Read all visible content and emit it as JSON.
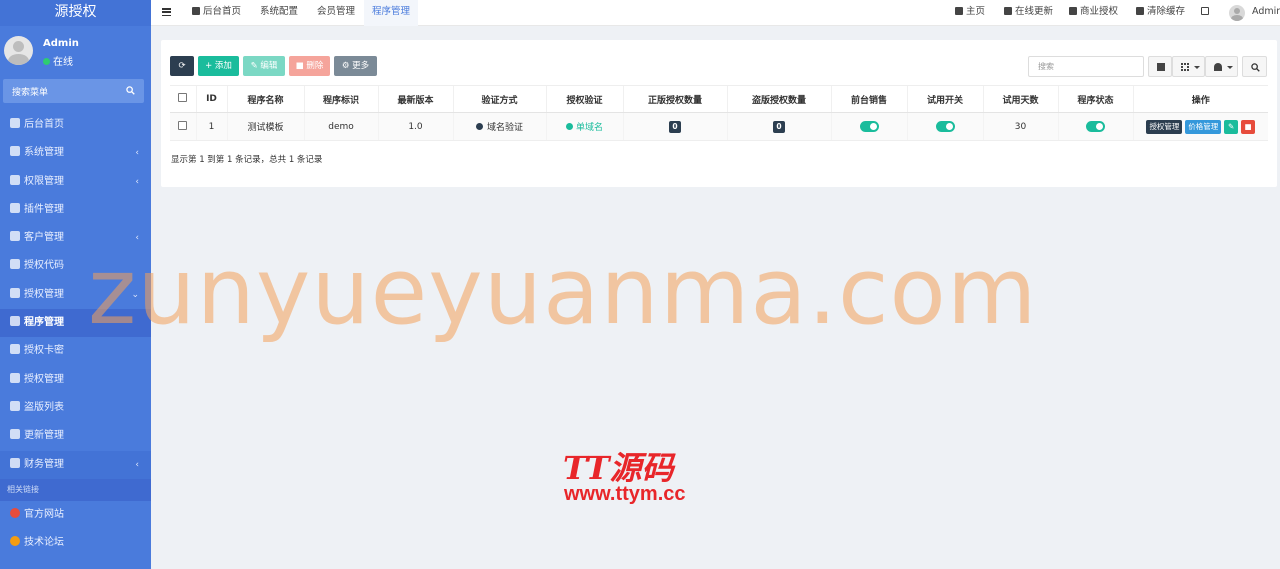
{
  "sidebar": {
    "brand": "源授权",
    "user": {
      "name": "Admin",
      "status": "在线"
    },
    "search_label": "搜索菜单",
    "items": [
      {
        "label": "后台首页",
        "icon": "dashboard-icon",
        "has_sub": false
      },
      {
        "label": "系统管理",
        "icon": "cogs-icon",
        "has_sub": true
      },
      {
        "label": "权限管理",
        "icon": "group-icon",
        "has_sub": true
      },
      {
        "label": "插件管理",
        "icon": "rocket-icon",
        "has_sub": false
      },
      {
        "label": "客户管理",
        "icon": "list-icon",
        "has_sub": true
      },
      {
        "label": "授权代码",
        "icon": "code-icon",
        "has_sub": false
      },
      {
        "label": "授权管理",
        "icon": "shield-icon",
        "has_sub": true,
        "open": true
      },
      {
        "label": "程序管理",
        "icon": "cloud-icon",
        "active": true
      },
      {
        "label": "授权卡密",
        "icon": "card-icon"
      },
      {
        "label": "授权管理",
        "icon": "copy-icon"
      },
      {
        "label": "盗版列表",
        "icon": "user-secret-icon"
      },
      {
        "label": "更新管理",
        "icon": "vimeo-icon"
      },
      {
        "label": "财务管理",
        "icon": "send-icon",
        "has_sub": true
      }
    ],
    "section_label": "相关链接",
    "links": [
      {
        "label": "官方网站",
        "color": "#e74c3c"
      },
      {
        "label": "技术论坛",
        "color": "#f39c12"
      }
    ]
  },
  "topnav": {
    "tabs": [
      "后台首页",
      "系统配置",
      "会员管理",
      "程序管理"
    ],
    "active_tab": "程序管理",
    "right": [
      "主页",
      "在线更新",
      "商业授权",
      "清除缓存"
    ],
    "user": "Admin"
  },
  "toolbar": {
    "add": "添加",
    "edit": "编辑",
    "del": "删除",
    "more": "更多",
    "search_placeholder": "搜索"
  },
  "table": {
    "headers": [
      "ID",
      "程序名称",
      "程序标识",
      "最新版本",
      "验证方式",
      "授权验证",
      "正版授权数量",
      "盗版授权数量",
      "前台销售",
      "试用开关",
      "试用天数",
      "程序状态",
      "操作"
    ],
    "rows": [
      {
        "id": "1",
        "name": "测试模板",
        "ident": "demo",
        "version": "1.0",
        "verify": "域名验证",
        "auth": "单域名",
        "licensed": "0",
        "pirated": "0",
        "sale": true,
        "trial": true,
        "trial_days": "30",
        "status": true,
        "op_auth": "授权管理",
        "op_price": "价格管理"
      }
    ]
  },
  "pager": "显示第 1 到第 1 条记录，总共 1 条记录",
  "watermark": {
    "text": "zunyueyuanma.com",
    "logo": "TT源码",
    "url": "www.ttym.cc"
  }
}
